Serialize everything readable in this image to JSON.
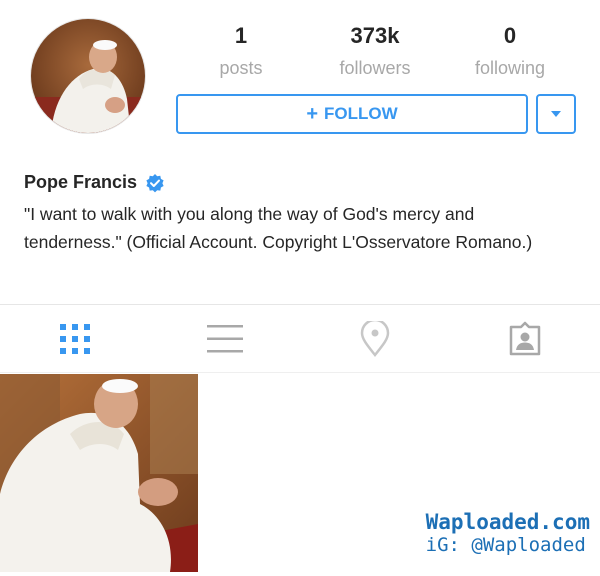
{
  "profile": {
    "name": "Pope Francis",
    "verified": true,
    "bio": "\"I want to walk with you along the way of God's mercy and tenderness.\" (Official Account. Copyright L'Osservatore Romano.)"
  },
  "stats": [
    {
      "value": "1",
      "label": "posts"
    },
    {
      "value": "373k",
      "label": "followers"
    },
    {
      "value": "0",
      "label": "following"
    }
  ],
  "actions": {
    "follow_label": "FOLLOW",
    "follow_plus": "+",
    "dropdown_icon": "caret-down-icon"
  },
  "tabs": [
    {
      "id": "grid",
      "icon": "grid-icon",
      "active": true
    },
    {
      "id": "list",
      "icon": "list-icon",
      "active": false
    },
    {
      "id": "map",
      "icon": "map-pin-icon",
      "active": false
    },
    {
      "id": "tagged",
      "icon": "tagged-photos-icon",
      "active": false
    }
  ],
  "watermark": {
    "line1": "Waploaded.com",
    "line2": "iG: @Waploaded"
  },
  "colors": {
    "accent": "#3897f0",
    "active_tab": "#3897f0",
    "inactive_tab": "#c7c7c7",
    "muted_text": "#a8a8a8"
  }
}
